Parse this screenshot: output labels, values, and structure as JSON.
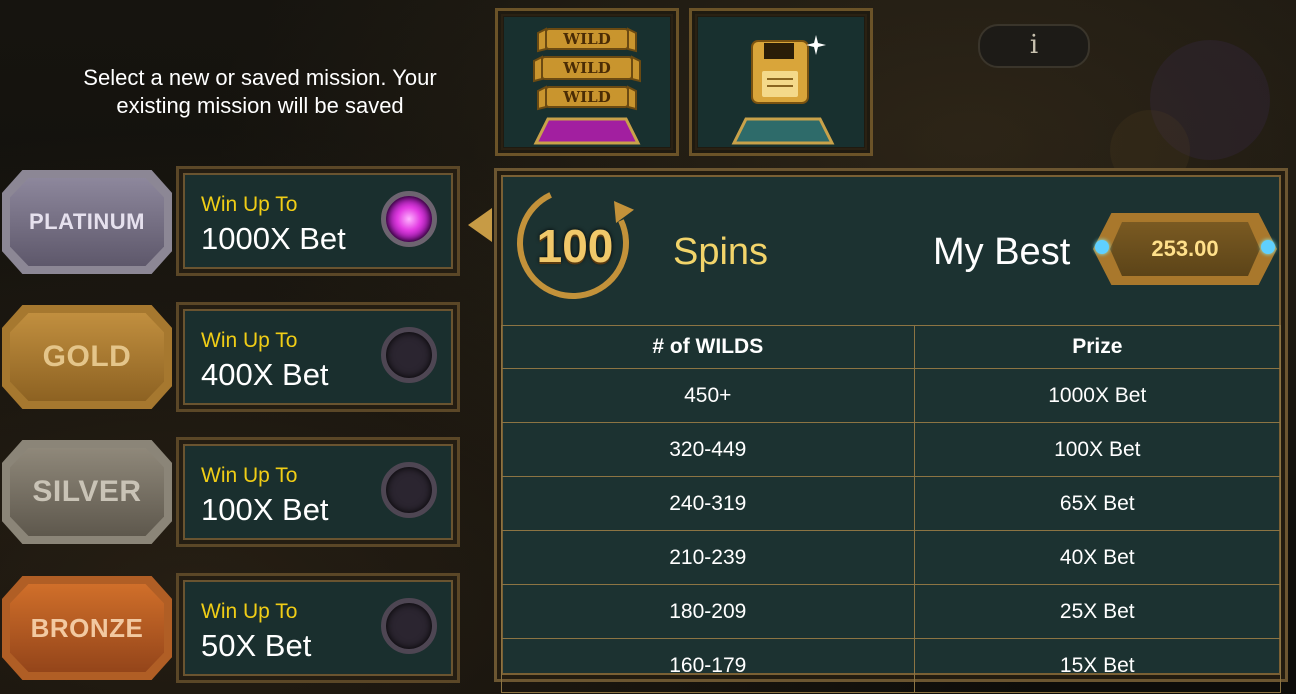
{
  "instruction": "Select a new or saved mission. Your existing mission will be saved",
  "top_buttons": {
    "wild_icon": "wild-banners-icon",
    "wild_banner_text": [
      "WILD",
      "WILD",
      "WILD"
    ],
    "save_icon": "floppy-disk-icon",
    "info_label": "i"
  },
  "tiers": [
    {
      "name": "PLATINUM",
      "win_label": "Win Up To",
      "bet": "1000X Bet",
      "selected": true
    },
    {
      "name": "GOLD",
      "win_label": "Win Up To",
      "bet": "400X Bet",
      "selected": false
    },
    {
      "name": "SILVER",
      "win_label": "Win Up To",
      "bet": "100X Bet",
      "selected": false
    },
    {
      "name": "BRONZE",
      "win_label": "Win Up To",
      "bet": "50X Bet",
      "selected": false
    }
  ],
  "detail": {
    "spins_count": "100",
    "spins_label": "Spins",
    "best_label": "My Best",
    "best_value": "253.00",
    "table": {
      "headers": [
        "# of WILDS",
        "Prize"
      ],
      "rows": [
        [
          "450+",
          "1000X Bet"
        ],
        [
          "320-449",
          "100X Bet"
        ],
        [
          "240-319",
          "65X Bet"
        ],
        [
          "210-239",
          "40X Bet"
        ],
        [
          "180-209",
          "25X Bet"
        ],
        [
          "160-179",
          "15X Bet"
        ]
      ]
    }
  },
  "colors": {
    "panel_bg": "#1c3231",
    "frame_gold": "#6c5631",
    "win_text": "#f0cd16",
    "spins_text": "#f2d46a",
    "active_orb": "#e23ce2"
  }
}
